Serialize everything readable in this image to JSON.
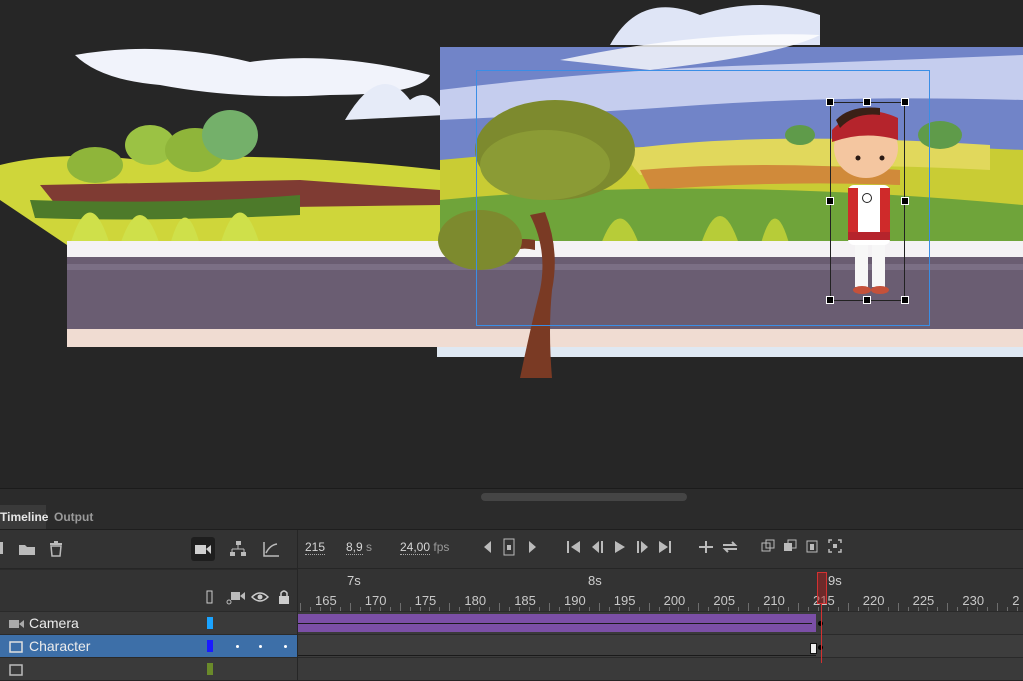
{
  "panel_tabs": {
    "timeline": "Timeline",
    "output": "Output"
  },
  "layer_toolbar": {
    "icons": [
      "new-layer-icon",
      "new-folder-icon",
      "delete-layer-icon",
      "camera-icon",
      "layer-parenting-icon",
      "graph-icon"
    ]
  },
  "transport": {
    "current_frame": "215",
    "elapsed_value": "8,9",
    "elapsed_unit": "s",
    "fps_value": "24,00",
    "fps_unit": "fps"
  },
  "header_icons": [
    "highlight-icon",
    "camera-attach-icon",
    "eye-icon",
    "lock-icon"
  ],
  "ruler": {
    "seconds": [
      "7s",
      "8s",
      "9s"
    ],
    "frames": [
      "165",
      "170",
      "175",
      "180",
      "185",
      "190",
      "195",
      "200",
      "205",
      "210",
      "215",
      "220",
      "225",
      "230",
      "2"
    ]
  },
  "layers": [
    {
      "name": "Camera",
      "color": "#1aa3ff"
    },
    {
      "name": "Character",
      "color": "#1a1aff",
      "selected": true
    },
    {
      "name": "",
      "color": "#6a8a2a"
    }
  ],
  "colors": {
    "accent": "#3a8ee6",
    "selected_layer": "#3d6fa8",
    "tween_span": "#7b4fa6",
    "playhead": "#d43131"
  }
}
